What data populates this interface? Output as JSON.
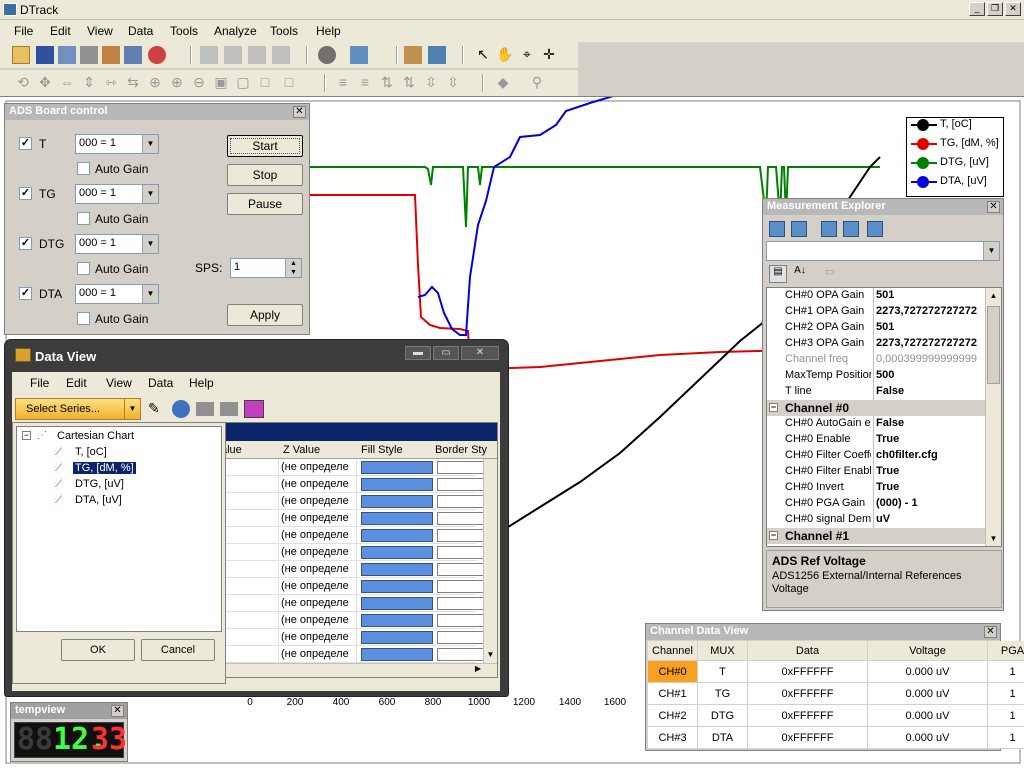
{
  "window": {
    "title": "DTrack"
  },
  "menu": [
    "File",
    "Edit",
    "View",
    "Data",
    "Tools",
    "Analyze",
    "Tools",
    "Help"
  ],
  "ads": {
    "title": "ADS Board control",
    "channels": [
      {
        "name": "T",
        "checked": true,
        "combo": "000 = 1",
        "autogain": "Auto Gain",
        "autogain_checked": false
      },
      {
        "name": "TG",
        "checked": true,
        "combo": "000 = 1",
        "autogain": "Auto Gain",
        "autogain_checked": false
      },
      {
        "name": "DTG",
        "checked": true,
        "combo": "000 = 1",
        "autogain": "Auto Gain",
        "autogain_checked": false
      },
      {
        "name": "DTA",
        "checked": true,
        "combo": "000 = 1",
        "autogain": "Auto Gain",
        "autogain_checked": false
      }
    ],
    "buttons": {
      "start": "Start",
      "stop": "Stop",
      "pause": "Pause",
      "apply": "Apply"
    },
    "sps_label": "SPS:",
    "sps_value": "1"
  },
  "legend": [
    {
      "label": "T, [oC]",
      "color": "#000000"
    },
    {
      "label": "TG, [dM, %]",
      "color": "#e00000"
    },
    {
      "label": "DTG, [uV]",
      "color": "#008000"
    },
    {
      "label": "DTA, [uV]",
      "color": "#0000e0"
    }
  ],
  "chart_data": {
    "type": "line",
    "x_ticks": [
      "0",
      "200",
      "400",
      "600",
      "800",
      "1000",
      "1200",
      "1400",
      "1600"
    ],
    "series": [
      {
        "name": "T, [oC]",
        "color": "#000000"
      },
      {
        "name": "TG, [dM, %]",
        "color": "#e00000"
      },
      {
        "name": "DTG, [uV]",
        "color": "#008000"
      },
      {
        "name": "DTA, [uV]",
        "color": "#0000e0"
      }
    ]
  },
  "explorer": {
    "title": "Measurement Explorer",
    "rows": [
      {
        "n": "CH#0 OPA Gain",
        "v": "501"
      },
      {
        "n": "CH#1 OPA Gain",
        "v": "2273,727272727272"
      },
      {
        "n": "CH#2 OPA Gain",
        "v": "501"
      },
      {
        "n": "CH#3 OPA Gain",
        "v": "2273,727272727272"
      },
      {
        "n": "Channel freq",
        "v": "0,000399999999999",
        "gray": true
      },
      {
        "n": "MaxTemp Position",
        "v": "500"
      },
      {
        "n": "T line",
        "v": "False"
      }
    ],
    "cat0": "Channel #0",
    "rows0": [
      {
        "n": "CH#0 AutoGain e",
        "v": "False"
      },
      {
        "n": "CH#0 Enable",
        "v": "True"
      },
      {
        "n": "CH#0 Filter Coeffe",
        "v": "ch0filter.cfg"
      },
      {
        "n": "CH#0 Filter Enabl",
        "v": "True"
      },
      {
        "n": "CH#0 Invert",
        "v": "True"
      },
      {
        "n": "CH#0 PGA Gain",
        "v": "(000) - 1"
      },
      {
        "n": "CH#0 signal Dem",
        "v": "uV"
      }
    ],
    "cat1": "Channel #1",
    "desc_title": "ADS Ref Voltage",
    "desc_text": "ADS1256 External/Internal References Voltage"
  },
  "dataview": {
    "title": "Data View",
    "menu": [
      "File",
      "Edit",
      "View",
      "Data",
      "Help"
    ],
    "select_series": "Select Series...",
    "tree_root": "Cartesian Chart",
    "tree_items": [
      "T, [oC]",
      "TG, [dM, %]",
      "DTG, [uV]",
      "DTA, [uV]"
    ],
    "ok": "OK",
    "cancel": "Cancel",
    "columns": [
      "alue",
      "Z Value",
      "Fill Style",
      "Border Sty"
    ],
    "zvalue": "(не определе"
  },
  "cdv": {
    "title": "Channel Data View",
    "headers": [
      "Channel",
      "MUX",
      "Data",
      "Voltage",
      "PGA"
    ],
    "rows": [
      [
        "CH#0",
        "T",
        "0xFFFFFF",
        "0.000 uV",
        "1"
      ],
      [
        "CH#1",
        "TG",
        "0xFFFFFF",
        "0.000 uV",
        "1"
      ],
      [
        "CH#2",
        "DTG",
        "0xFFFFFF",
        "0.000 uV",
        "1"
      ],
      [
        "CH#3",
        "DTA",
        "0xFFFFFF",
        "0.000 uV",
        "1"
      ]
    ]
  },
  "tempview": {
    "title": "tempview",
    "digits_dim": "88",
    "digits_lit": "12.",
    "digits_red": "33"
  }
}
